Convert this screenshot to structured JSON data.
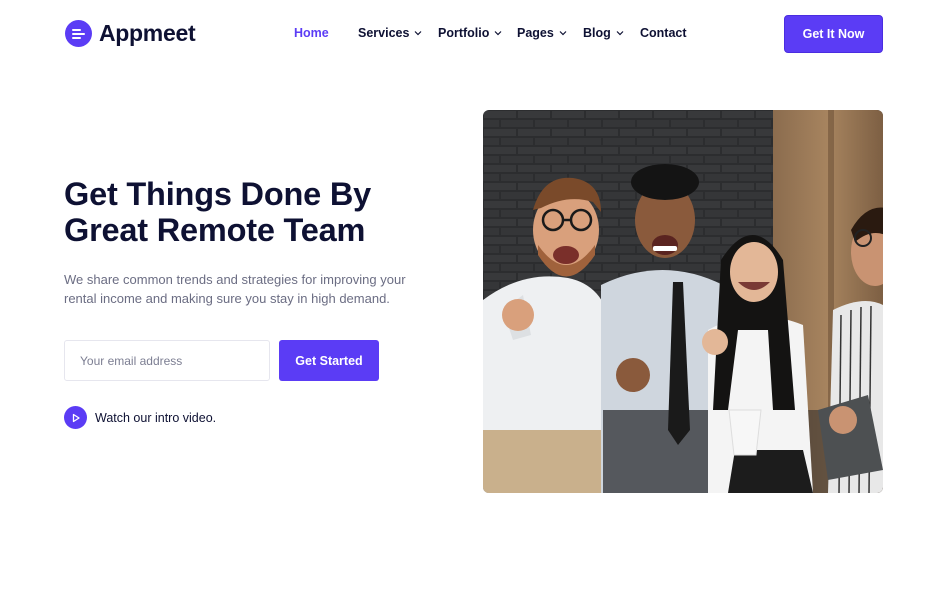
{
  "brand": {
    "name": "Appmeet",
    "accent": "#5b3cf5",
    "text_dark": "#0e1133"
  },
  "nav": {
    "items": [
      {
        "label": "Home",
        "active": true,
        "has_dropdown": false
      },
      {
        "label": "Services",
        "active": false,
        "has_dropdown": true
      },
      {
        "label": "Portfolio",
        "active": false,
        "has_dropdown": true
      },
      {
        "label": "Pages",
        "active": false,
        "has_dropdown": true
      },
      {
        "label": "Blog",
        "active": false,
        "has_dropdown": true
      },
      {
        "label": "Contact",
        "active": false,
        "has_dropdown": false
      }
    ],
    "cta_label": "Get It Now"
  },
  "hero": {
    "title_line1": "Get Things Done By",
    "title_line2": "Great Remote Team",
    "description": "We share common trends and strategies for improving your rental income and making sure you stay in high demand.",
    "email_placeholder": "Your email address",
    "email_value": "",
    "submit_label": "Get Started",
    "video_label": "Watch our intro video.",
    "video_icon": "play-icon",
    "image": "photo of four cheering colleagues"
  }
}
